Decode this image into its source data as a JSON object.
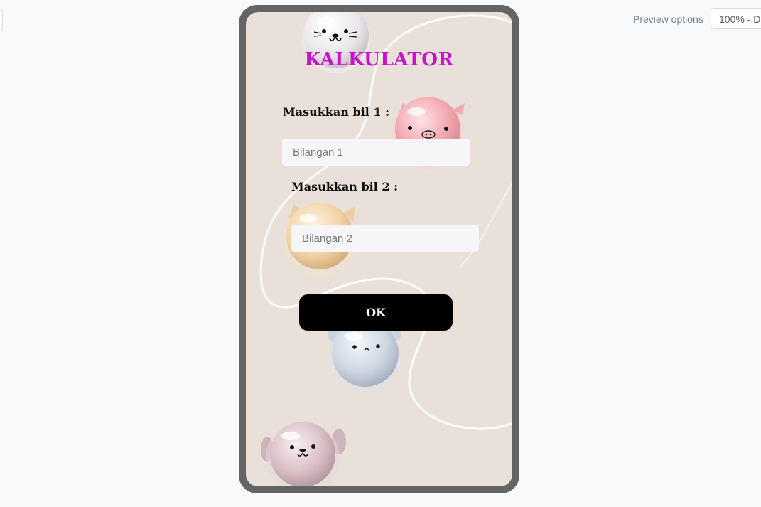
{
  "toolbar": {
    "preview_options_label": "Preview options",
    "zoom_value": "100% - D"
  },
  "app": {
    "title": "KALKULATOR",
    "label_1": "Masukkan bil 1 :",
    "placeholder_1": "Bilangan 1",
    "label_2": "Masukkan bil 2 :",
    "placeholder_2": "Bilangan 2",
    "ok_label": "OK"
  },
  "colors": {
    "title": "#c90fd0",
    "frame": "#646464",
    "button": "#000000",
    "wallpaper": "#e9e1d9"
  },
  "icons": [
    "seal-face-icon",
    "pig-face-icon",
    "cat-face-icon",
    "bear-face-icon",
    "dog-face-icon"
  ]
}
